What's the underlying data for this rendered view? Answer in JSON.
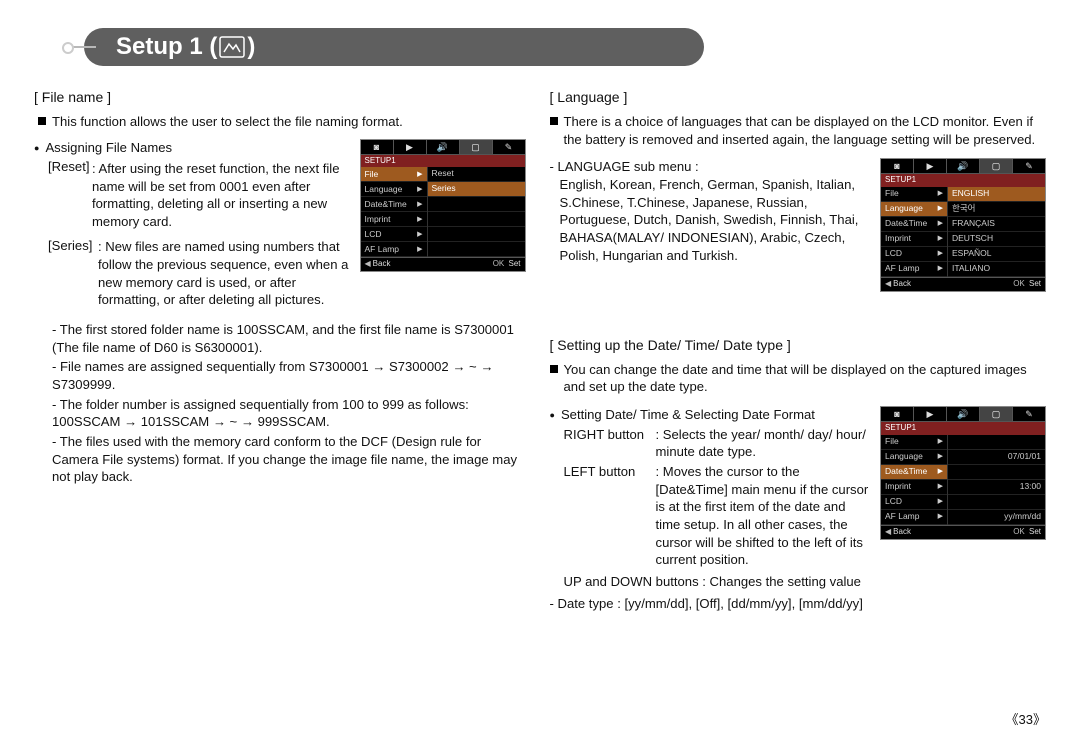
{
  "page": {
    "title_prefix": "Setup 1 ( ",
    "title_suffix": " )",
    "page_number": "《33》"
  },
  "filename": {
    "heading": "[ File name ]",
    "intro": "This function allows the user to select the file naming format.",
    "assign_heading": "Assigning File Names",
    "reset_label": "[Reset]",
    "reset_text": ": After using the reset function, the next file name will be set from 0001 even after formatting, deleting all or inserting a new memory card.",
    "series_label": "[Series]",
    "series_text": ": New files are named using numbers that follow the previous sequence, even when a new memory card is used, or after formatting, or after deleting all pictures.",
    "notes": [
      "- The first stored folder name is 100SSCAM, and the first file name is S7300001 (The file name of D60 is S6300001).",
      "- File names are assigned sequentially from S7300001 → S7300002 → ~ → S7309999.",
      "- The folder number is assigned sequentially from 100 to 999 as follows: 100SSCAM → 101SSCAM → ~ → 999SSCAM.",
      "- The files used with the memory card conform to the DCF (Design rule for Camera File systems) format. If you change the image file name, the image may not play back."
    ],
    "lcd": {
      "tabs_active": 3,
      "setup_label": "SETUP1",
      "menu": [
        "File",
        "Language",
        "Date&Time",
        "Imprint",
        "LCD",
        "AF Lamp"
      ],
      "active_menu": 0,
      "values": [
        "Reset",
        "Series",
        "",
        "",
        "",
        ""
      ],
      "active_value": 1,
      "footer_back_k": "◀",
      "footer_back_l": "Back",
      "footer_ok_k": "OK",
      "footer_ok_l": "Set"
    }
  },
  "language": {
    "heading": "[ Language ]",
    "intro": "There is a choice of languages that can be displayed on the LCD monitor. Even if the battery is removed and inserted again, the language setting will be preserved.",
    "sub_label": "- LANGUAGE sub menu :",
    "sub_list": "English, Korean, French, German, Spanish, Italian, S.Chinese, T.Chinese, Japanese, Russian, Portuguese, Dutch, Danish, Swedish, Finnish, Thai, BAHASA(MALAY/ INDONESIAN), Arabic, Czech, Polish, Hungarian and Turkish.",
    "lcd": {
      "setup_label": "SETUP1",
      "menu": [
        "File",
        "Language",
        "Date&Time",
        "Imprint",
        "LCD",
        "AF Lamp"
      ],
      "active_menu": 1,
      "values": [
        "ENGLISH",
        "한국어",
        "FRANÇAIS",
        "DEUTSCH",
        "ESPAÑOL",
        "ITALIANO"
      ],
      "active_value": 0,
      "footer_back_k": "◀",
      "footer_back_l": "Back",
      "footer_ok_k": "OK",
      "footer_ok_l": "Set"
    }
  },
  "datetime": {
    "heading": "[ Setting up the Date/ Time/ Date type ]",
    "intro": "You can change the date and time that will be displayed on the captured images and set up the date type.",
    "sub_heading": "Setting Date/ Time & Selecting Date Format",
    "right_label": "RIGHT button",
    "right_text": ": Selects the year/ month/ day/ hour/ minute date type.",
    "left_label": "LEFT button",
    "left_text": ": Moves the cursor to the [Date&Time] main menu if the cursor is at the first item of the date and time setup. In all other cases, the cursor will be shifted to the left of its current position.",
    "updown": "UP and DOWN buttons : Changes the setting value",
    "datetype": "- Date type : [yy/mm/dd], [Off], [dd/mm/yy], [mm/dd/yy]",
    "lcd": {
      "setup_label": "SETUP1",
      "menu": [
        "File",
        "Language",
        "Date&Time",
        "Imprint",
        "LCD",
        "AF Lamp"
      ],
      "active_menu": 2,
      "values": [
        "",
        "07/01/01",
        "",
        "13:00",
        "",
        "yy/mm/dd"
      ],
      "active_value": -1,
      "footer_back_k": "◀",
      "footer_back_l": "Back",
      "footer_ok_k": "OK",
      "footer_ok_l": "Set"
    }
  }
}
